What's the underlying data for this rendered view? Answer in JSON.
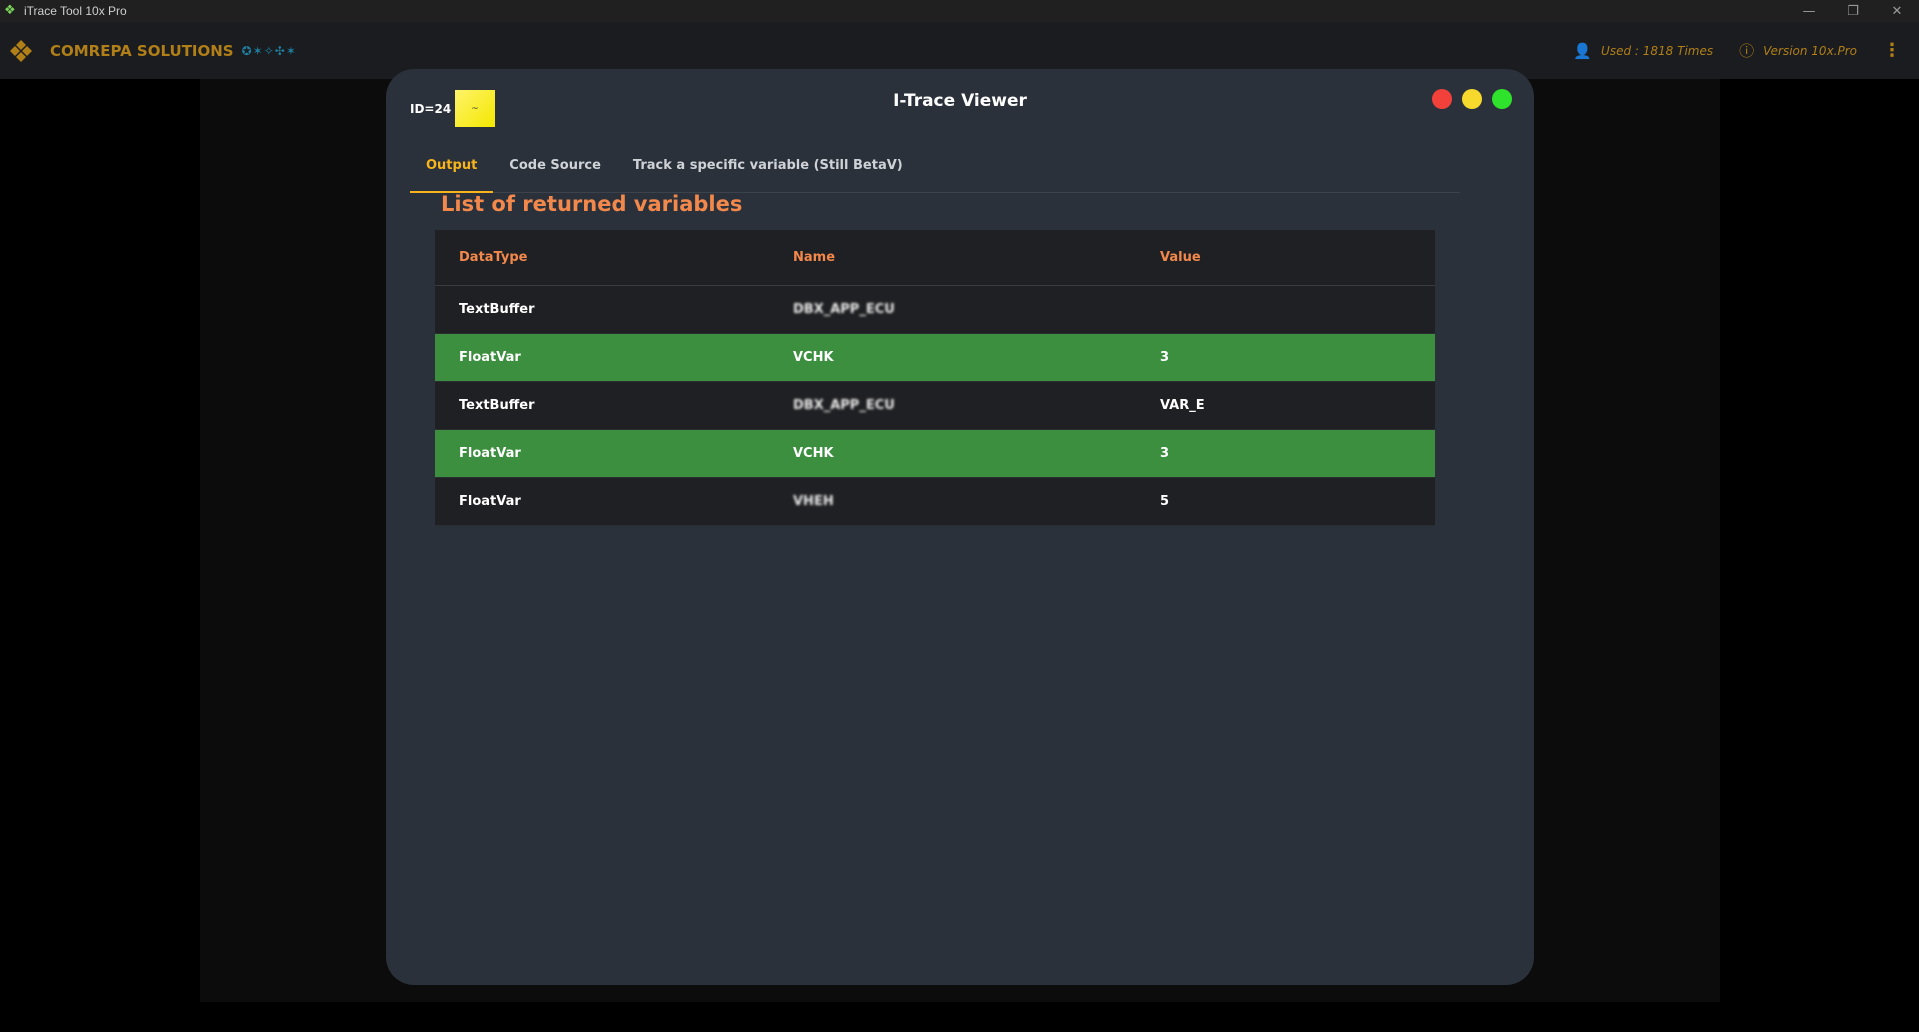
{
  "window": {
    "title": "iTrace Tool 10x Pro",
    "controls": {
      "minimize": "—",
      "restore": "❐",
      "close": "✕"
    }
  },
  "appbar": {
    "brand": "COMREPA SOLUTIONS",
    "stars": "✪✶✧✣✶",
    "used": "Used : 1818 Times",
    "version": "Version 10x.Pro",
    "menu": "⋮"
  },
  "viewer": {
    "id_label": "ID=24",
    "badge": "~",
    "title": "I-Trace Viewer",
    "tabs": [
      {
        "label": "Output"
      },
      {
        "label": "Code Source"
      },
      {
        "label": "Track a specific variable (Still BetaV)"
      }
    ],
    "active_tab": "Output",
    "section_title": "List of returned variables",
    "table": {
      "headers": [
        "DataType",
        "Name",
        "Value"
      ],
      "rows": [
        {
          "type": "TextBuffer",
          "name": "DBX_APP_ECU",
          "value": "",
          "highlight": false
        },
        {
          "type": "FloatVar",
          "name": "VCHK",
          "value": "3",
          "highlight": true
        },
        {
          "type": "TextBuffer",
          "name": "DBX_APP_ECU",
          "value": "VAR_E",
          "highlight": false
        },
        {
          "type": "FloatVar",
          "name": "VCHK",
          "value": "3",
          "highlight": true
        },
        {
          "type": "FloatVar",
          "name": "VHEH",
          "value": "5",
          "highlight": false
        }
      ]
    }
  },
  "colors": {
    "accent": "#f7b51b",
    "heading": "#f2884b",
    "brand": "#b07f18",
    "row_highlight": "#3b8f3f"
  }
}
